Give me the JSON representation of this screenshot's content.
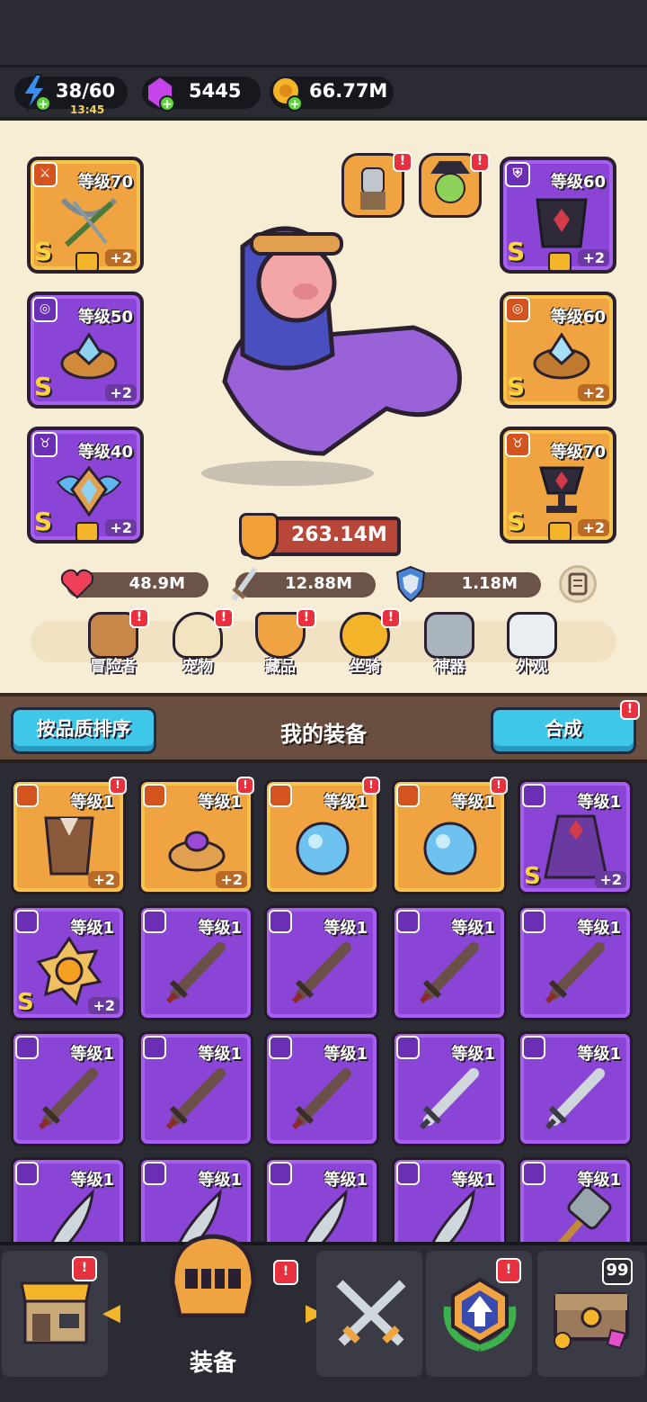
{
  "resources": {
    "energy": "38/60",
    "energy_timer": "13:45",
    "gems": "5445",
    "gold": "66.77M"
  },
  "equip_left": [
    {
      "level": "等级70",
      "grade": "S",
      "plus": "+2"
    },
    {
      "level": "等级50",
      "grade": "S",
      "plus": "+2"
    },
    {
      "level": "等级40",
      "grade": "S",
      "plus": "+2"
    }
  ],
  "equip_right": [
    {
      "level": "等级60",
      "grade": "S",
      "plus": "+2"
    },
    {
      "level": "等级60",
      "grade": "S",
      "plus": "+2"
    },
    {
      "level": "等级70",
      "grade": "S",
      "plus": "+2"
    }
  ],
  "badges": {
    "alert": "!",
    "chest_count": "99"
  },
  "power": "263.14M",
  "stats": {
    "hp": "48.9M",
    "attack": "12.88M",
    "defense": "1.18M"
  },
  "nav": [
    {
      "label": "冒险者"
    },
    {
      "label": "宠物"
    },
    {
      "label": "藏品"
    },
    {
      "label": "坐骑"
    },
    {
      "label": "神器"
    },
    {
      "label": "外观"
    }
  ],
  "inventory_header": {
    "sort_button": "按品质排序",
    "title": "我的装备",
    "merge_button": "合成"
  },
  "items": [
    {
      "level": "等级1",
      "rarity": "gold",
      "plus": "+2",
      "grade": "",
      "art": "armor"
    },
    {
      "level": "等级1",
      "rarity": "gold",
      "plus": "+2",
      "grade": "",
      "art": "ring"
    },
    {
      "level": "等级1",
      "rarity": "gold",
      "plus": "",
      "grade": "",
      "art": "orb"
    },
    {
      "level": "等级1",
      "rarity": "gold",
      "plus": "",
      "grade": "",
      "art": "orb"
    },
    {
      "level": "等级1",
      "rarity": "purple",
      "plus": "+2",
      "grade": "S",
      "art": "cloak"
    },
    {
      "level": "等级1",
      "rarity": "purple",
      "plus": "+2",
      "grade": "S",
      "art": "medal"
    },
    {
      "level": "等级1",
      "rarity": "purple",
      "plus": "",
      "grade": "",
      "art": "sword-wood"
    },
    {
      "level": "等级1",
      "rarity": "purple",
      "plus": "",
      "grade": "",
      "art": "sword-wood"
    },
    {
      "level": "等级1",
      "rarity": "purple",
      "plus": "",
      "grade": "",
      "art": "sword-wood"
    },
    {
      "level": "等级1",
      "rarity": "purple",
      "plus": "",
      "grade": "",
      "art": "sword-wood"
    },
    {
      "level": "等级1",
      "rarity": "purple",
      "plus": "",
      "grade": "",
      "art": "sword-wood"
    },
    {
      "level": "等级1",
      "rarity": "purple",
      "plus": "",
      "grade": "",
      "art": "sword-wood"
    },
    {
      "level": "等级1",
      "rarity": "purple",
      "plus": "",
      "grade": "",
      "art": "sword-wood"
    },
    {
      "level": "等级1",
      "rarity": "purple",
      "plus": "",
      "grade": "",
      "art": "sword-steel"
    },
    {
      "level": "等级1",
      "rarity": "purple",
      "plus": "",
      "grade": "",
      "art": "sword-steel"
    },
    {
      "level": "等级1",
      "rarity": "purple",
      "plus": "",
      "grade": "",
      "art": "scimitar"
    },
    {
      "level": "等级1",
      "rarity": "purple",
      "plus": "",
      "grade": "",
      "art": "scimitar"
    },
    {
      "level": "等级1",
      "rarity": "purple",
      "plus": "",
      "grade": "",
      "art": "scimitar"
    },
    {
      "level": "等级1",
      "rarity": "purple",
      "plus": "",
      "grade": "",
      "art": "scimitar"
    },
    {
      "level": "等级1",
      "rarity": "purple",
      "plus": "",
      "grade": "",
      "art": "hammer"
    }
  ],
  "bottom_tab": {
    "active_label": "装备"
  },
  "colors": {
    "gold_frame": "#f0a441",
    "purple_frame": "#8b45d6",
    "accent_cyan": "#3ec7e8",
    "badge_red": "#e8313f"
  }
}
